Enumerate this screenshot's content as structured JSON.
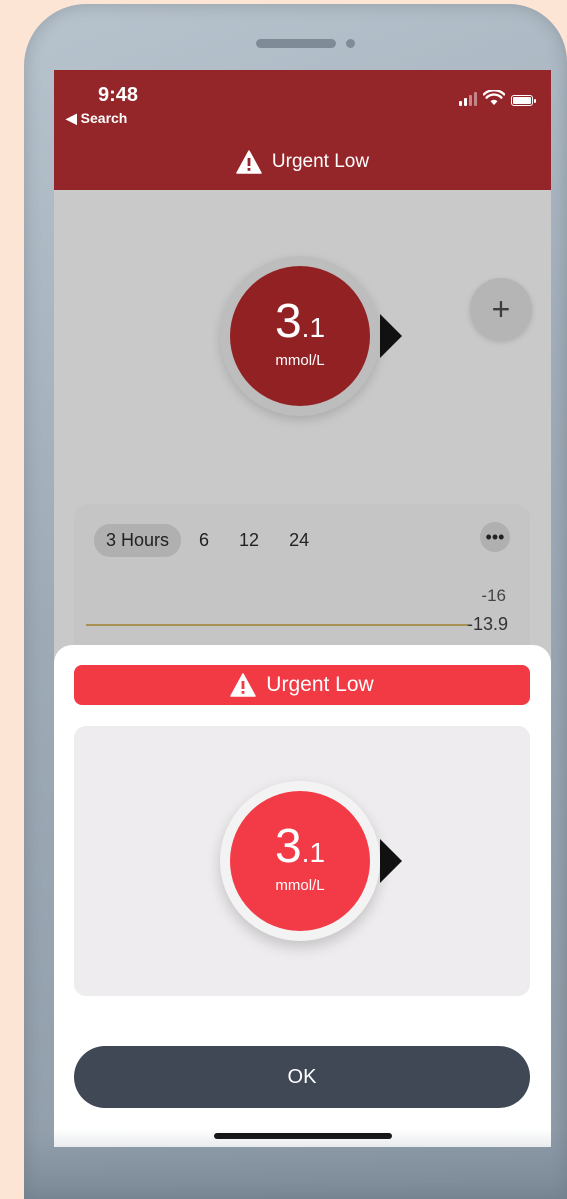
{
  "status_bar": {
    "time": "9:48",
    "back_label": "◀ Search"
  },
  "nav": {
    "title": "Urgent Low",
    "warning_icon": "warning-triangle-icon"
  },
  "current_reading": {
    "value_int": "3",
    "value_dec": ".1",
    "unit": "mmol/L",
    "trend_icon": "trend-arrow-right-icon"
  },
  "add_button": {
    "label": "+"
  },
  "chart": {
    "range_tabs": [
      "3 Hours",
      "6",
      "12",
      "24"
    ],
    "selected_range": "3 Hours",
    "more_label": "•••",
    "y_labels": [
      "-16",
      "-13.9"
    ]
  },
  "alert_modal": {
    "banner_title": "Urgent Low",
    "value_int": "3",
    "value_dec": ".1",
    "unit": "mmol/L",
    "ok_label": "OK"
  },
  "colors": {
    "urgent_red": "#f23a45",
    "nav_red": "#942528",
    "ok_button": "#3f4854"
  }
}
